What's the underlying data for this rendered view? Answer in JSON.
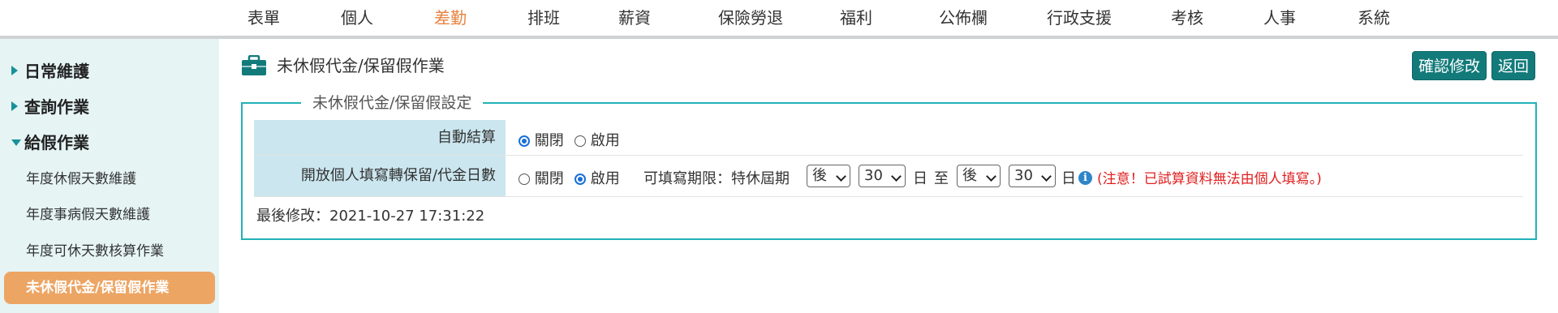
{
  "topnav": {
    "items": [
      "表單",
      "個人",
      "差勤",
      "排班",
      "薪資",
      "保險勞退",
      "福利",
      "公佈欄",
      "行政支援",
      "考核",
      "人事",
      "系統"
    ],
    "active": "差勤",
    "accent_color": "#e8823e"
  },
  "sidebar": {
    "groups": [
      "日常維護",
      "查詢作業",
      "給假作業"
    ],
    "sub_items": [
      "年度休假天數維護",
      "年度事病假天數維護",
      "年度可休天數核算作業",
      "未休假代金/保留假作業"
    ],
    "active_item": "未休假代金/保留假作業"
  },
  "page": {
    "icon": "briefcase-icon",
    "title": "未休假代金/保留假作業",
    "confirm_button": "確認修改",
    "back_button": "返回"
  },
  "settings": {
    "legend": "未休假代金/保留假設定",
    "auto_settle": {
      "label": "自動結算",
      "option_off": "關閉",
      "option_on": "啟用",
      "selected": "關閉"
    },
    "open_personal": {
      "label": "開放個人填寫轉保留/代金日數",
      "option_off": "關閉",
      "option_on": "啟用",
      "selected": "啟用",
      "period_label": "可填寫期限：特休屆期",
      "from_dir": "後",
      "from_days": "30",
      "day_unit1": "日",
      "to": "至",
      "to_dir": "後",
      "to_days": "30",
      "day_unit2": "日",
      "notice": "(注意！已試算資料無法由個人填寫。)"
    },
    "last_modified": "最後修改：2021-10-27 17:31:22"
  }
}
